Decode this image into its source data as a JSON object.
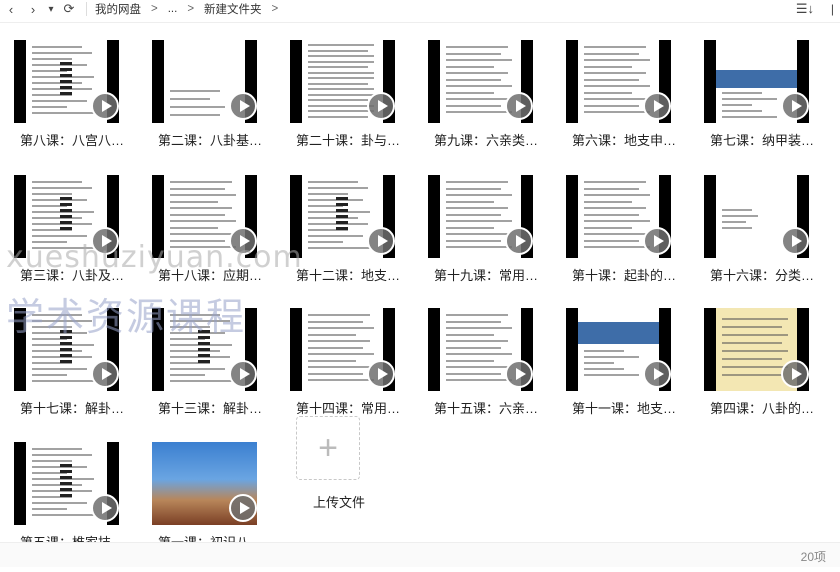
{
  "toolbar": {
    "back_icon": "‹",
    "forward_icon": "›",
    "dropdown_icon": "▾",
    "refresh_icon": "⟳",
    "breadcrumb": [
      "我的网盘",
      "...",
      "新建文件夹"
    ],
    "crumb_sep": ">",
    "sort_icon": "☰↓",
    "more_icon": "|"
  },
  "files": [
    {
      "label": "第八课：八宫八…",
      "thumb": "doc"
    },
    {
      "label": "第二课：八卦基…",
      "thumb": "diagram"
    },
    {
      "label": "第二十课：卦与…",
      "thumb": "table"
    },
    {
      "label": "第九课：六亲类…",
      "thumb": "text"
    },
    {
      "label": "第六课：地支申…",
      "thumb": "text"
    },
    {
      "label": "第七课：纳甲装…",
      "thumb": "bluetable"
    },
    {
      "label": "第三课：八卦及…",
      "thumb": "doc"
    },
    {
      "label": "第十八课：应期…",
      "thumb": "text"
    },
    {
      "label": "第十二课：地支…",
      "thumb": "doc"
    },
    {
      "label": "第十九课：常用…",
      "thumb": "text"
    },
    {
      "label": "第十课：起卦的…",
      "thumb": "text"
    },
    {
      "label": "第十六课：分类…",
      "thumb": "sparse"
    },
    {
      "label": "第十七课：解卦…",
      "thumb": "doc"
    },
    {
      "label": "第十三课：解卦…",
      "thumb": "doc"
    },
    {
      "label": "第十四课：常用…",
      "thumb": "text"
    },
    {
      "label": "第十五课：六亲…",
      "thumb": "text"
    },
    {
      "label": "第十一课：地支…",
      "thumb": "bluehead"
    },
    {
      "label": "第四课：八卦的…",
      "thumb": "yellowtable"
    },
    {
      "label": "第五课：椎家技…",
      "thumb": "doc"
    },
    {
      "label": "第一课：初识八…",
      "thumb": "photo"
    }
  ],
  "upload": {
    "icon": "+",
    "label": "上传文件"
  },
  "status": {
    "count": "20项"
  },
  "watermark": {
    "line1": "xueshuziyuan.com",
    "line2": "学术资源课程"
  },
  "colors": {
    "thumb_border": "#000000",
    "play_button": "#6e6e6e"
  }
}
